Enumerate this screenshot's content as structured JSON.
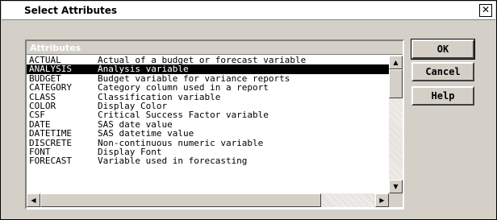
{
  "dialog": {
    "title": "Select Attributes",
    "close_glyph": "✕"
  },
  "list": {
    "header": "Attributes",
    "selected_index": 1,
    "items": [
      {
        "name": "ACTUAL",
        "description": "Actual of a budget or forecast variable"
      },
      {
        "name": "ANALYSIS",
        "description": "Analysis variable"
      },
      {
        "name": "BUDGET",
        "description": "Budget variable for variance reports"
      },
      {
        "name": "CATEGORY",
        "description": "Category column used in a report"
      },
      {
        "name": "CLASS",
        "description": "Classification variable"
      },
      {
        "name": "COLOR",
        "description": "Display Color"
      },
      {
        "name": "CSF",
        "description": "Critical Success Factor variable"
      },
      {
        "name": "DATE",
        "description": "SAS date value"
      },
      {
        "name": "DATETIME",
        "description": "SAS datetime value"
      },
      {
        "name": "DISCRETE",
        "description": "Non-continuous numeric variable"
      },
      {
        "name": "FONT",
        "description": "Display Font"
      },
      {
        "name": "FORECAST",
        "description": "Variable used in forecasting"
      }
    ]
  },
  "scrollbars": {
    "up_arrow": "▲",
    "down_arrow": "▼",
    "left_arrow": "◀",
    "right_arrow": "▶"
  },
  "buttons": {
    "ok": "OK",
    "cancel": "Cancel",
    "help": "Help"
  }
}
